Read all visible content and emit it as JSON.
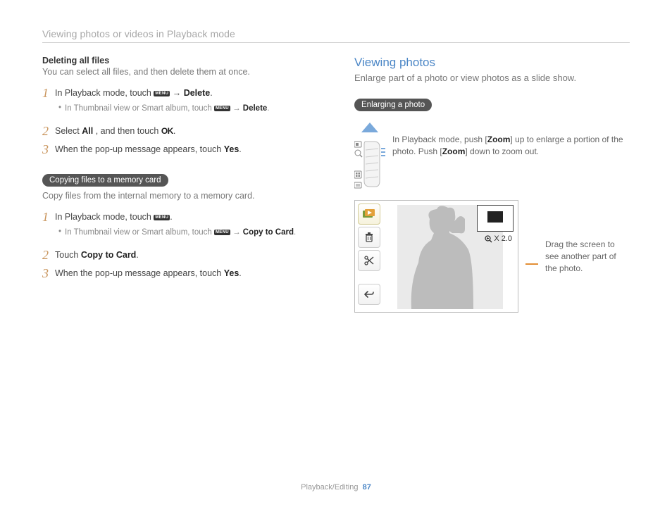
{
  "header": "Viewing photos or videos in Playback mode",
  "left": {
    "sec1_title": "Deleting all files",
    "sec1_desc": "You can select all files, and then delete them at once.",
    "s1a_pre": "In Playback mode, touch ",
    "s1a_post": " → ",
    "s1a_bold": "Delete",
    "s1a_end": ".",
    "s1_sub_pre": "In Thumbnail view or Smart album, touch ",
    "s1_sub_post": " → ",
    "s1_sub_bold": "Delete",
    "s1_sub_end": ".",
    "s2_pre": "Select ",
    "s2_bold": "All",
    "s2_mid": ", and then touch ",
    "s2_end": ".",
    "s3_pre": "When the pop-up message appears, touch ",
    "s3_bold": "Yes",
    "s3_end": ".",
    "pill": "Copying files to a memory card",
    "copy_desc": "Copy files from the internal memory to a memory card.",
    "c1_pre": "In Playback mode, touch ",
    "c1_end": ".",
    "c1_sub_pre": "In Thumbnail view or Smart album, touch ",
    "c1_sub_post": " → ",
    "c1_sub_bold": "Copy to Card",
    "c1_sub_end": ".",
    "c2_pre": "Touch ",
    "c2_bold": "Copy to Card",
    "c2_end": ".",
    "c3_pre": "When the pop-up message appears, touch ",
    "c3_bold": "Yes",
    "c3_end": "."
  },
  "right": {
    "title": "Viewing photos",
    "desc": "Enlarge part of a photo or view photos as a slide show.",
    "pill": "Enlarging a photo",
    "zoom_pre": "In Playback mode, push [",
    "zoom_b1": "Zoom",
    "zoom_mid": "] up to enlarge a portion of the photo. Push [",
    "zoom_b2": "Zoom",
    "zoom_post": "] down to zoom out.",
    "zlabel": "X 2.0",
    "callout": "Drag the screen to see another part of the photo."
  },
  "icons": {
    "menu": "MENU",
    "ok": "OK"
  },
  "nums": {
    "n1": "1",
    "n2": "2",
    "n3": "3"
  },
  "footer": {
    "section": "Playback/Editing",
    "page": "87"
  }
}
